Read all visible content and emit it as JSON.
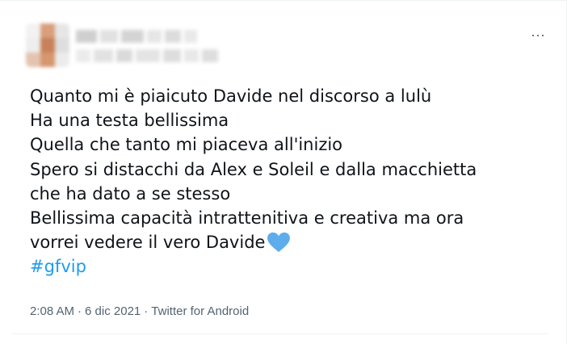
{
  "tweet": {
    "more_label": "···",
    "lines": [
      "Quanto mi è piaicuto Davide nel discorso a lulù",
      "Ha una testa bellissima",
      "Quella che tanto mi piaceva all'inizio",
      "Spero si distacchi da Alex e Soleil e dalla macchietta",
      "che ha dato a se stesso",
      "Bellissima capacità intrattenitiva e creativa ma ora",
      "vorrei vedere il vero Davide"
    ],
    "heart_emoji": "blue-heart",
    "hashtag": "#gfvip",
    "time": "2:08 AM",
    "date": "6 dic 2021",
    "source": "Twitter for Android",
    "separator": "·"
  },
  "colors": {
    "text": "#0f1419",
    "link": "#1d9bf0",
    "meta": "#536471",
    "heart": "#5dadec",
    "border": "#eff3f4"
  }
}
